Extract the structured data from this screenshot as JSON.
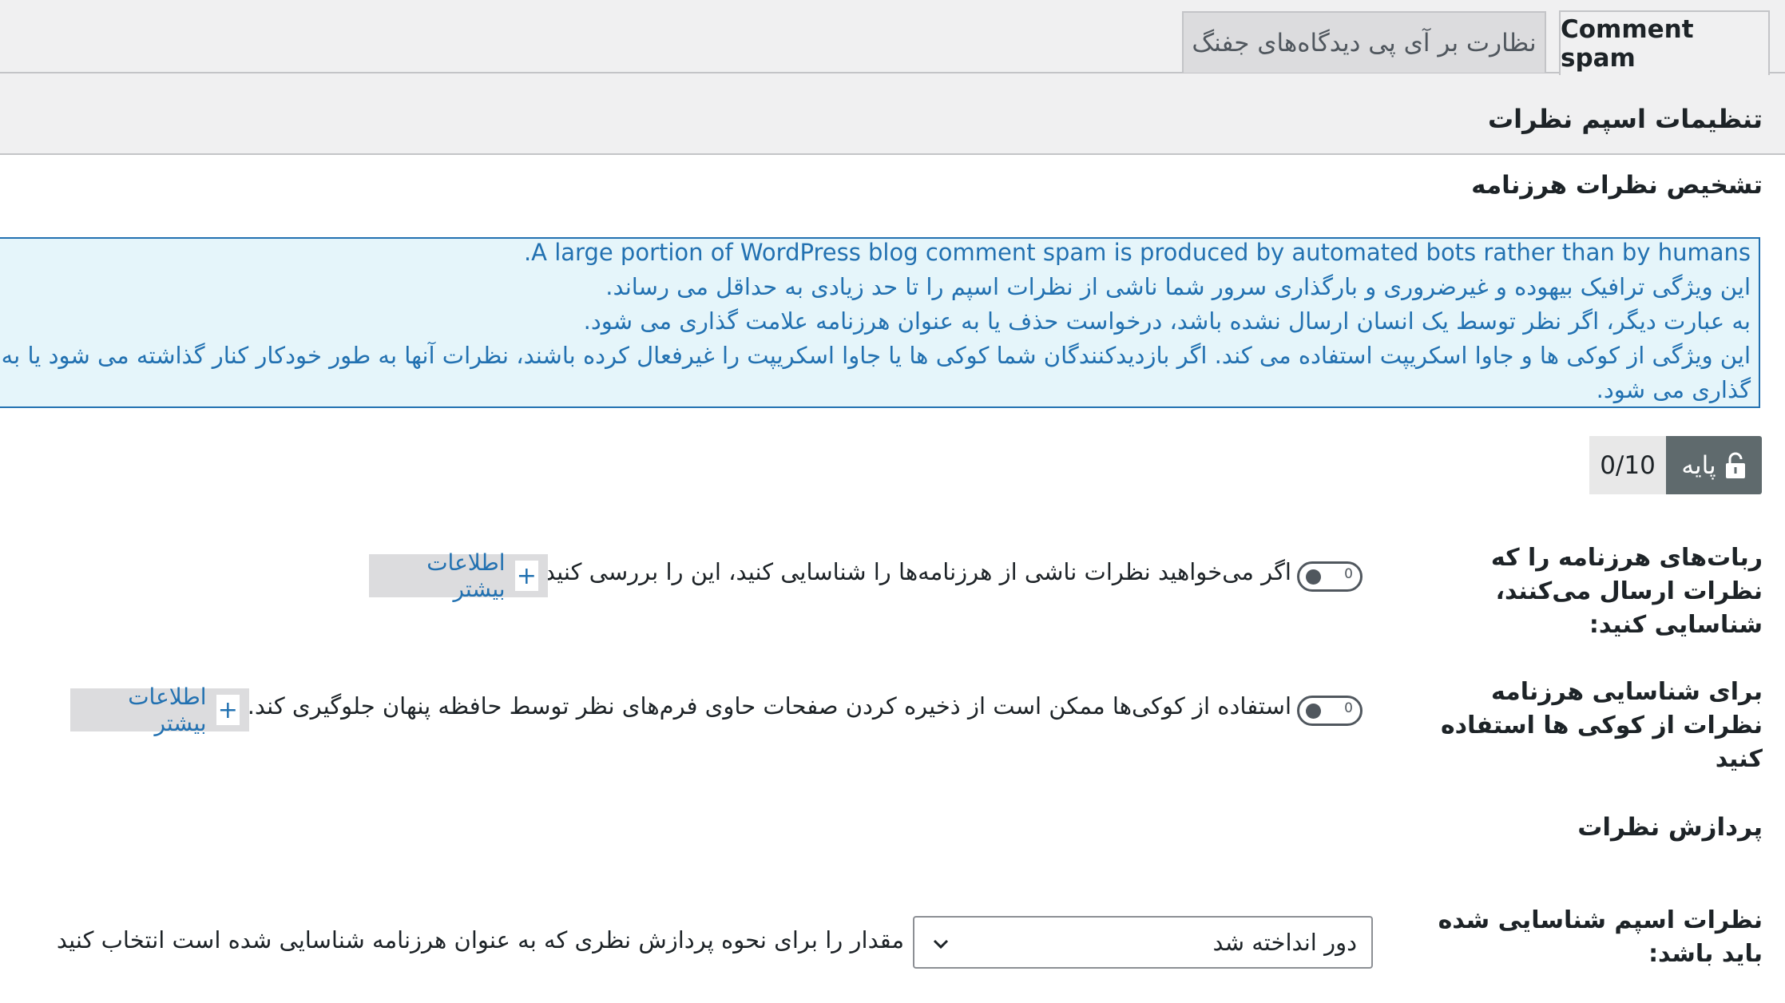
{
  "tabs": [
    {
      "label": "Comment spam",
      "active": true
    },
    {
      "label": "نظارت بر آی پی دیدگاه‌های جفنگ",
      "active": false
    }
  ],
  "section": {
    "title": "تنظیمات اسپم نظرات"
  },
  "detection": {
    "title": "تشخیص نظرات هرزنامه",
    "info_lines": [
      "A large portion of WordPress blog comment spam is produced by automated bots rather than by humans.",
      "این ویژگی ترافیک بیهوده و غیرضروری و بارگذاری سرور شما ناشی از نظرات اسپم را تا حد زیادی به حداقل می رساند.",
      "به عبارت دیگر، اگر نظر توسط یک انسان ارسال نشده باشد، درخواست حذف یا به عنوان هرزنامه علامت گذاری می شود.",
      "این ویژگی از کوکی ها و جاوا اسکریپت استفاده می کند. اگر بازدیدکنندگان شما کوکی ها یا جاوا اسکریپت را غیرفعال کرده باشند، نظرات آنها به طور خودکار کنار گذاشته می شود یا به عنوان هرزنامه علامت",
      "گذاری می شود."
    ]
  },
  "score": {
    "label": "پایه",
    "count": "0/10"
  },
  "rows": [
    {
      "label": "ربات‌های هرزنامه را که نظرات ارسال می‌کنند، شناسایی کنید:",
      "toggle_text": "0",
      "description": "اگر می‌خواهید نظرات ناشی از هرزنامه‌ها را شناسایی کنید، این را بررسی کنید.",
      "more": "اطلاعات بیشتر"
    },
    {
      "label": "برای شناسایی هرزنامه نظرات از کوکی ها استفاده کنید",
      "toggle_text": "0",
      "description": "استفاده از کوکی‌ها ممکن است از ذخیره کردن صفحات حاوی فرم‌های نظر توسط حافظه پنهان جلوگیری کند.",
      "more": "اطلاعات بیشتر"
    }
  ],
  "processing": {
    "title": "پردازش نظرات",
    "row_label": "نظرات اسپم شناسایی شده باید باشد:",
    "select_value": "دور انداخته شد",
    "select_desc": "مقدار را برای نحوه پردازش نظری که به عنوان هرزنامه شناسایی شده است انتخاب کنید"
  },
  "colors": {
    "accent": "#2271b1",
    "background": "#f0f0f1",
    "info_bg": "#e5f5fa"
  }
}
